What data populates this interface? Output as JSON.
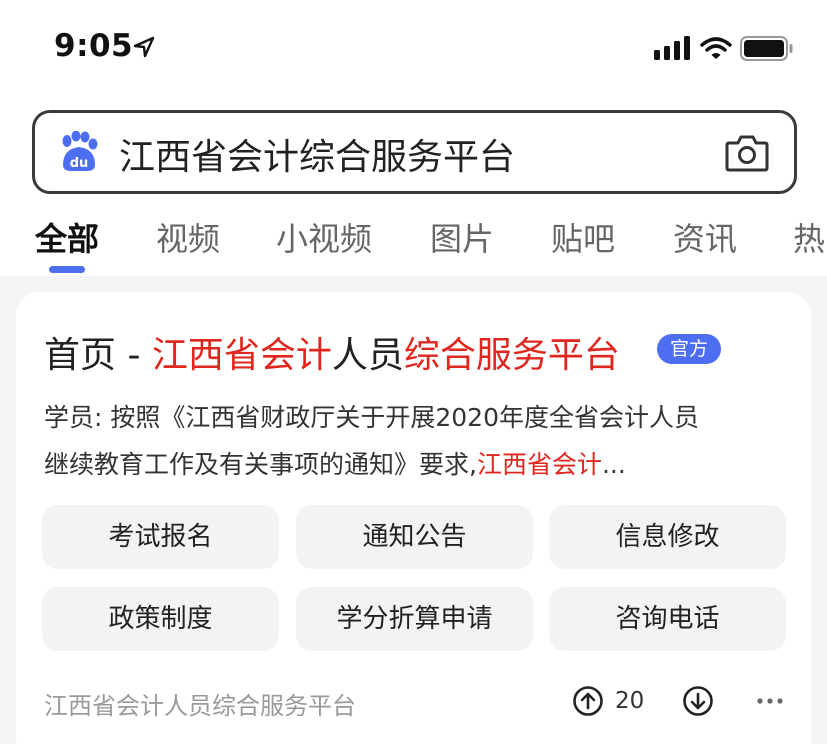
{
  "status_bar": {
    "time": "9:05",
    "icons": [
      "location-arrow-icon",
      "signal-icon",
      "wifi-icon",
      "battery-icon"
    ]
  },
  "search": {
    "logo_icon": "baidu-paw-icon",
    "query": "江西省会计综合服务平台",
    "camera_icon": "camera-icon"
  },
  "tabs": [
    {
      "label": "全部",
      "active": true
    },
    {
      "label": "视频"
    },
    {
      "label": "小视频"
    },
    {
      "label": "图片"
    },
    {
      "label": "贴吧"
    },
    {
      "label": "资讯"
    },
    {
      "label": "热"
    }
  ],
  "result": {
    "title_parts": [
      "首页 - ",
      "江西省会计",
      "人员",
      "综合服务平台"
    ],
    "badge": "官方",
    "snippet_line1": "学员: 按照《江西省财政厅关于开展2020年度全省会计人员",
    "snippet_line2_plain": "继续教育工作及有关事项的通知》要求,",
    "snippet_line2_highlight": "江西省会计",
    "snippet_line2_ellipsis": "...",
    "links": [
      "考试报名",
      "通知公告",
      "信息修改",
      "政策制度",
      "学分折算申请",
      "咨询电话"
    ],
    "source": "江西省会计人员综合服务平台",
    "vote_count": "20"
  },
  "colors": {
    "highlight": "#e0271f",
    "accent": "#4e6ef2",
    "button_bg": "#f2f3f5"
  }
}
